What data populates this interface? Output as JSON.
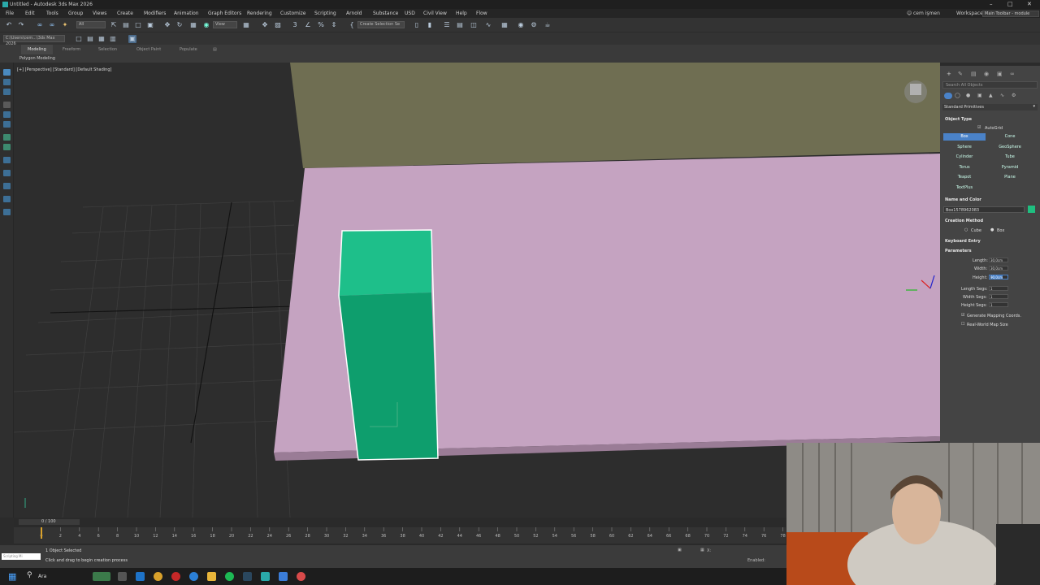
{
  "window": {
    "title": "Untitled - Autodesk 3ds Max 2026",
    "min": "–",
    "max": "□",
    "close": "✕"
  },
  "menu": {
    "items": [
      "File",
      "Edit",
      "Tools",
      "Group",
      "Views",
      "Create",
      "Modifiers",
      "Animation",
      "Graph Editors",
      "Rendering",
      "Customize",
      "Scripting",
      "Arnold",
      "Substance",
      "USD",
      "Civil View",
      "Help",
      "Flow"
    ],
    "user": "cem işmen",
    "workspaces_label": "Workspaces:",
    "workspace_value": "Main Toolbar - module"
  },
  "toolbar": {
    "selection_filter": "All",
    "view_dropdown": "View",
    "create_selection_set": "Create Selection Se",
    "project_path": "C:\\Users\\cem...\\3ds Max 2026"
  },
  "ribbon": {
    "tabs": [
      "Modeling",
      "Freeform",
      "Selection",
      "Object Paint",
      "Populate"
    ],
    "active_tab": "Modeling",
    "sub_label": "Polygon Modeling"
  },
  "viewport": {
    "label": "[+] [Perspective] [Standard] [Default Shading]"
  },
  "command_panel": {
    "search_placeholder": "Search All Objects",
    "category": "Standard Primitives",
    "object_type_header": "Object Type",
    "autogrid": "AutoGrid",
    "buttons": [
      "Box",
      "Cone",
      "Sphere",
      "GeoSphere",
      "Cylinder",
      "Tube",
      "Torus",
      "Pyramid",
      "Teapot",
      "Plane",
      "TextPlus"
    ],
    "active_button": "Box",
    "name_color_header": "Name and Color",
    "object_name": "Box1578962083",
    "object_color": "#1fbf80",
    "creation_method_header": "Creation Method",
    "creation_method": {
      "cube": "Cube",
      "box": "Box"
    },
    "keyboard_entry_header": "Keyboard Entry",
    "parameters_header": "Parameters",
    "params": [
      {
        "label": "Length:",
        "value": "30,0cm"
      },
      {
        "label": "Width:",
        "value": "30,0cm"
      },
      {
        "label": "Height:",
        "value": "90,0cm"
      }
    ],
    "segs": [
      {
        "label": "Length Segs:",
        "value": "1"
      },
      {
        "label": "Width Segs:",
        "value": "1"
      },
      {
        "label": "Height Segs:",
        "value": "1"
      }
    ],
    "gen_mapping": "Generate Mapping Coords.",
    "real_world": "Real-World Map Size"
  },
  "timeline": {
    "frame_readout": "0 / 100",
    "ticks": [
      "0",
      "2",
      "4",
      "6",
      "8",
      "10",
      "12",
      "14",
      "16",
      "18",
      "20",
      "22",
      "24",
      "26",
      "28",
      "30",
      "32",
      "34",
      "36",
      "38",
      "40",
      "42",
      "44",
      "46",
      "48",
      "50",
      "52",
      "54",
      "56",
      "58",
      "60",
      "62",
      "64",
      "66",
      "68",
      "70",
      "72",
      "74",
      "76",
      "78",
      "80"
    ]
  },
  "status": {
    "selected": "1 Object Selected",
    "prompt": "Click and drag to begin creation process",
    "script_label": "Scripting Mi",
    "x_label": "X:",
    "enabled": "Enabled:"
  },
  "taskbar": {
    "search": "Ara"
  }
}
